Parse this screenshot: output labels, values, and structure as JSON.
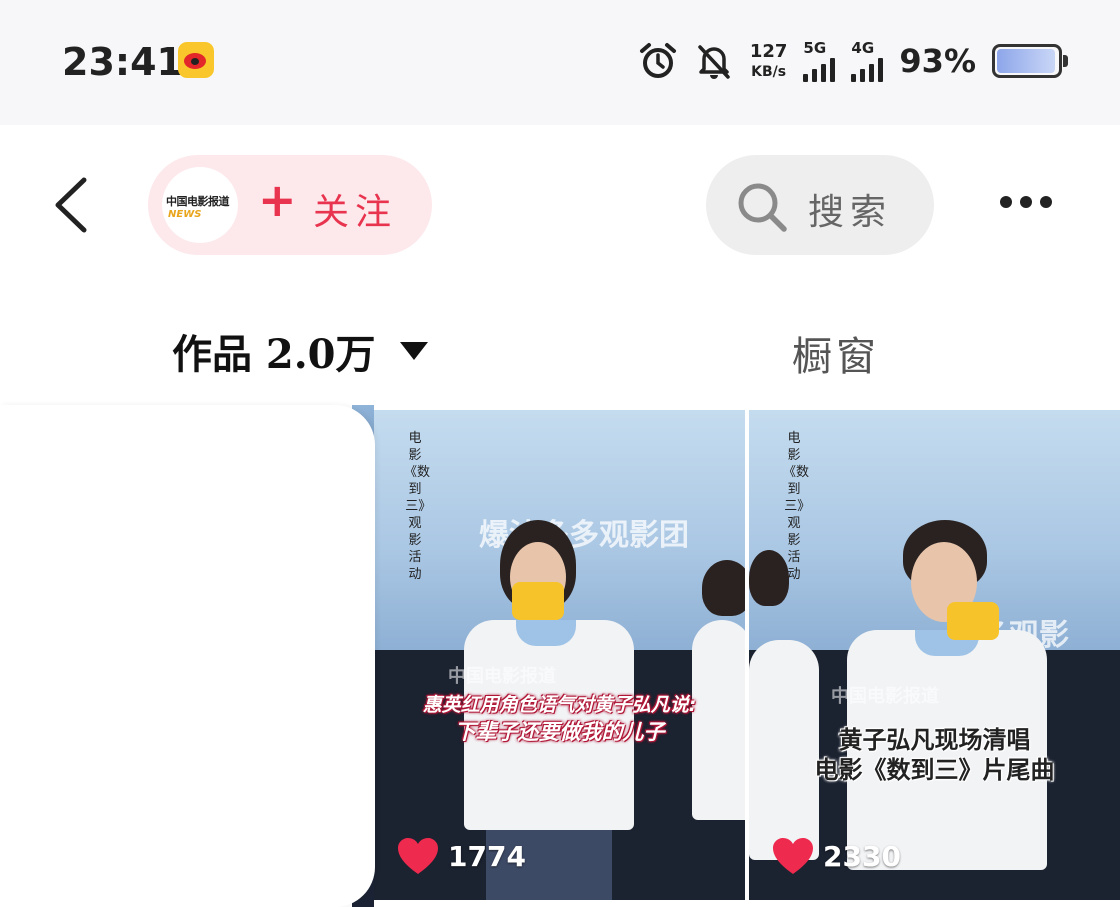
{
  "status_bar": {
    "time": "23:41",
    "speed_value": "127",
    "speed_unit": "KB/s",
    "sim1_label": "5G",
    "sim2_label": "4G",
    "battery_percent": "93%",
    "battery_level": 0.93,
    "icons": [
      "weibo-app-icon",
      "alarm-icon",
      "mute-bell-icon",
      "signal-icon",
      "battery-icon"
    ]
  },
  "header": {
    "account_logo_text": "中国电影报道",
    "account_logo_sub": "NEWS",
    "follow_plus": "+",
    "follow_label": "关注",
    "search_label": "搜索",
    "colors": {
      "follow_accent": "#e8344e",
      "follow_bg": "#fde8ec",
      "search_bg": "#eeeeee"
    }
  },
  "tabs": [
    {
      "label": "作品 2.0万",
      "active": true
    },
    {
      "label": "橱窗",
      "active": false
    }
  ],
  "videos": [
    {
      "vertical_text": "电影《数到三》观影活动",
      "banner_text": "爆汁多多观影团",
      "watermark": "中国电影报道",
      "caption_line1": "惠英红用角色语气对黄子弘凡说:",
      "caption_line2": "下辈子还要做我的儿子",
      "likes": "1774"
    },
    {
      "vertical_text": "电影《数到三》观影活动",
      "banner_text": "多多观影",
      "watermark": "中国电影报道",
      "caption_line1": "黄子弘凡现场清唱",
      "caption_line2": "电影《数到三》片尾曲",
      "likes": "2330"
    }
  ]
}
